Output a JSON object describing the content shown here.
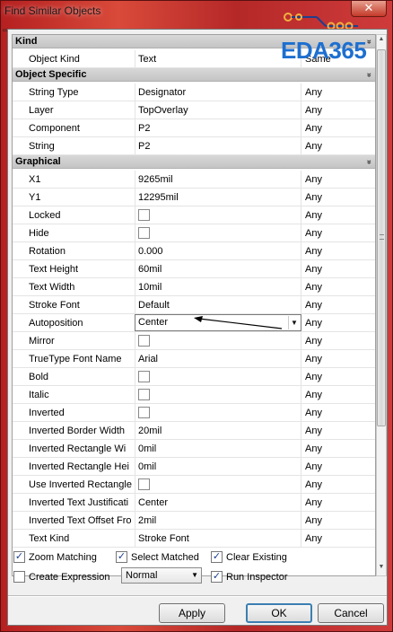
{
  "window": {
    "title": "Find Similar Objects",
    "close_label": "✕"
  },
  "watermark": {
    "logo_text": "EDA365"
  },
  "grid": {
    "categories": [
      {
        "label": "Kind"
      },
      {
        "label": "Object Specific"
      },
      {
        "label": "Graphical"
      }
    ],
    "kind_rows": [
      {
        "name": "Object Kind",
        "value": "Text",
        "match": "Same"
      }
    ],
    "specific_rows": [
      {
        "name": "String Type",
        "value": "Designator",
        "match": "Any"
      },
      {
        "name": "Layer",
        "value": "TopOverlay",
        "match": "Any"
      },
      {
        "name": "Component",
        "value": "P2",
        "match": "Any"
      },
      {
        "name": "String",
        "value": "P2",
        "match": "Any"
      }
    ],
    "graphical_rows": [
      {
        "name": "X1",
        "value": "9265mil",
        "match": "Any"
      },
      {
        "name": "Y1",
        "value": "12295mil",
        "match": "Any"
      },
      {
        "name": "Locked",
        "value": "",
        "match": "Any",
        "checkbox": true
      },
      {
        "name": "Hide",
        "value": "",
        "match": "Any",
        "checkbox": true
      },
      {
        "name": "Rotation",
        "value": "0.000",
        "match": "Any"
      },
      {
        "name": "Text Height",
        "value": "60mil",
        "match": "Any"
      },
      {
        "name": "Text Width",
        "value": "10mil",
        "match": "Any"
      },
      {
        "name": "Stroke Font",
        "value": "Default",
        "match": "Any"
      },
      {
        "name": "Autoposition",
        "value": "Center",
        "match": "Any",
        "combo": true
      },
      {
        "name": "Mirror",
        "value": "",
        "match": "Any",
        "checkbox": true
      },
      {
        "name": "TrueType Font Name",
        "value": "Arial",
        "match": "Any"
      },
      {
        "name": "Bold",
        "value": "",
        "match": "Any",
        "checkbox": true
      },
      {
        "name": "Italic",
        "value": "",
        "match": "Any",
        "checkbox": true
      },
      {
        "name": "Inverted",
        "value": "",
        "match": "Any",
        "checkbox": true
      },
      {
        "name": "Inverted Border Width",
        "value": "20mil",
        "match": "Any"
      },
      {
        "name": "Inverted Rectangle Wi",
        "value": "0mil",
        "match": "Any"
      },
      {
        "name": "Inverted Rectangle Hei",
        "value": "0mil",
        "match": "Any"
      },
      {
        "name": "Use Inverted Rectangle",
        "value": "",
        "match": "Any",
        "checkbox": true
      },
      {
        "name": "Inverted Text Justificati",
        "value": "Center",
        "match": "Any"
      },
      {
        "name": "Inverted Text Offset Fro",
        "value": "2mil",
        "match": "Any"
      },
      {
        "name": "Text Kind",
        "value": "Stroke Font",
        "match": "Any"
      }
    ]
  },
  "options": {
    "zoom_matching": {
      "label": "Zoom Matching",
      "checked": true
    },
    "select_matched": {
      "label": "Select Matched",
      "checked": true
    },
    "clear_existing": {
      "label": "Clear Existing",
      "checked": true
    },
    "create_expression": {
      "label": "Create Expression",
      "checked": false
    },
    "mode_select": {
      "value": "Normal"
    },
    "run_inspector": {
      "label": "Run Inspector",
      "checked": true
    }
  },
  "buttons": {
    "apply": "Apply",
    "ok": "OK",
    "cancel": "Cancel"
  }
}
